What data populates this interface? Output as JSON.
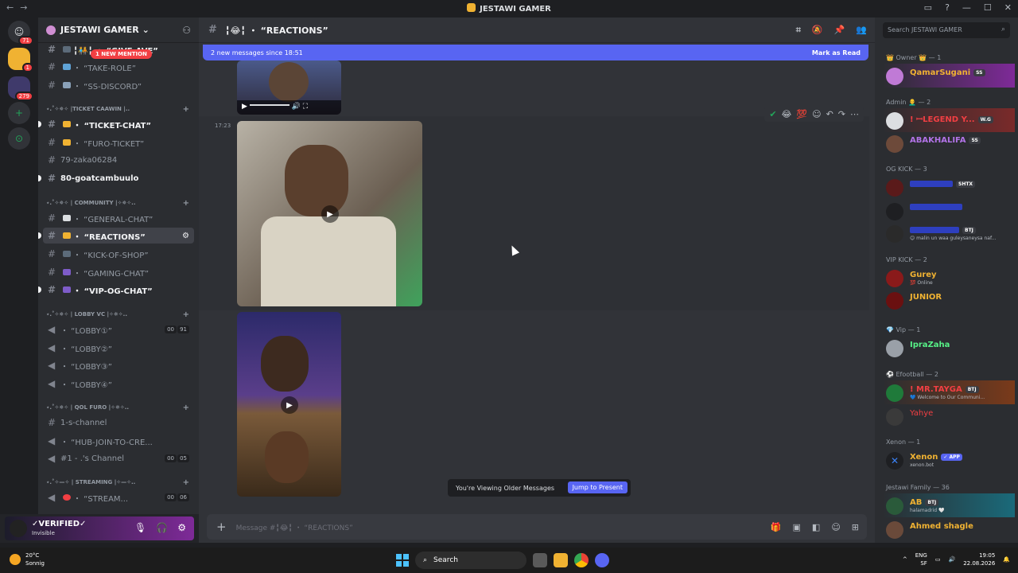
{
  "window": {
    "title": "JESTAWI GAMER",
    "nav_back": "←",
    "nav_forward": "→"
  },
  "server_rail": {
    "top_badge": "71",
    "items": [
      {
        "name": "direct-messages",
        "badge": "71"
      },
      {
        "name": "server-jestawi",
        "badge": "1"
      },
      {
        "name": "server-folder",
        "badge": "279"
      }
    ],
    "add_label": "+",
    "discover_label": "⊙"
  },
  "guild": {
    "name": "JESTAWI GAMER",
    "mention_pill": "1 NEW MENTION",
    "channels": [
      {
        "label": "╏🧑‍🤝‍🧑╏ ・ “GIVE-AVE”",
        "type": "text",
        "style": "bold"
      },
      {
        "label": "・ “TAKE-ROLE”",
        "type": "text",
        "style": "normal"
      },
      {
        "label": "・ “SS-DISCORD”",
        "type": "text",
        "style": "normal"
      },
      {
        "label": "⋆.˚✧✵✧ |TICKET CAAWIN |..",
        "type": "category"
      },
      {
        "label": "・ “TICKET-CHAT”",
        "type": "text",
        "style": "bold"
      },
      {
        "label": "・ “FURO-TICKET”",
        "type": "text",
        "style": "normal"
      },
      {
        "label": "79-zaka06284",
        "type": "text",
        "style": "normal"
      },
      {
        "label": "80-goatcambuulo",
        "type": "text",
        "style": "bold"
      },
      {
        "label": "⋆.˚✧✵✧ | COMMUNITY |✧✵✧..",
        "type": "category"
      },
      {
        "label": "・ “GENERAL-CHAT”",
        "type": "text",
        "style": "normal"
      },
      {
        "label": "・ “REACTIONS”",
        "type": "text",
        "style": "selected"
      },
      {
        "label": "・ “KICK-OF-SHOP”",
        "type": "text",
        "style": "normal"
      },
      {
        "label": "・ “GAMING-CHAT”",
        "type": "text",
        "style": "normal"
      },
      {
        "label": "・ “VIP-OG-CHAT”",
        "type": "text",
        "style": "bold"
      },
      {
        "label": "⋆.˚✧✵✧ | LOBBY VC |✧✵✧..",
        "type": "category"
      },
      {
        "label": "・ “LOBBY①”",
        "type": "voice",
        "tag1": "00",
        "tag2": "91"
      },
      {
        "label": "・ “LOBBY②”",
        "type": "voice"
      },
      {
        "label": "・ “LOBBY③”",
        "type": "voice"
      },
      {
        "label": "・ “LOBBY④”",
        "type": "voice"
      },
      {
        "label": "⋆.˚✧✵✧ | QOL FURO |✧✵✧..",
        "type": "category"
      },
      {
        "label": "1-s-channel",
        "type": "text",
        "style": "normal"
      },
      {
        "label": "・ “HUB-JOIN-TO-CRE...",
        "type": "voice"
      },
      {
        "label": "#1 - .'s Channel",
        "type": "voice",
        "tag1": "00",
        "tag2": "05"
      },
      {
        "label": "⋆.˚✧—✧ | STREAMING |✧—✧..",
        "type": "category"
      },
      {
        "label": "・ “STREAM...",
        "type": "voice",
        "tag1": "00",
        "tag2": "06"
      }
    ]
  },
  "user": {
    "name": "✓VERIFIED✓",
    "status": "Invisible"
  },
  "header": {
    "channel": "╏😂╏ ・ “REACTIONS”"
  },
  "banner": {
    "text": "2 new messages since 18:51",
    "action": "Mark as Read"
  },
  "message": {
    "timestamp": "17:23"
  },
  "older": {
    "text": "You're Viewing Older Messages",
    "action": "Jump to Present"
  },
  "composer": {
    "placeholder": "Message #╏😂╏ ・ “REACTIONS”"
  },
  "members_panel": {
    "search_placeholder": "Search JESTAWI GAMER",
    "groups": [
      {
        "title": "👑 Owner 👑 — 1",
        "members": [
          {
            "name": "QamarSugani",
            "tag": "SS",
            "color": "#f0b232",
            "sub": ""
          }
        ]
      },
      {
        "title": "Admin 👨‍🦲 — 2",
        "members": [
          {
            "name": "! ꟷLEGEND Y...",
            "tag": "W.G",
            "color": "#f23f43",
            "sub": ""
          },
          {
            "name": "ABAKHALIFA",
            "tag": "SS",
            "color": "#b273e8",
            "sub": ""
          }
        ]
      },
      {
        "title": "OG KICK — 3",
        "members": [
          {
            "name": "",
            "tag": "SHTX",
            "color": "#3b5bdb",
            "sub": ""
          },
          {
            "name": "",
            "tag": "",
            "color": "#3b5bdb",
            "sub": ""
          },
          {
            "name": "",
            "tag": "BTJ",
            "color": "#3b5bdb",
            "sub": "😊 malin un waa guleysaneysa naf..."
          }
        ]
      },
      {
        "title": "VIP KICK — 2",
        "members": [
          {
            "name": "Gurey",
            "tag": "",
            "color": "#f0b232",
            "sub": "💯 Online"
          },
          {
            "name": "JUNIOR",
            "tag": "",
            "color": "#f0b232",
            "sub": ""
          }
        ]
      },
      {
        "title": "💎 Vip — 1",
        "members": [
          {
            "name": "IpraZaha",
            "tag": "",
            "color": "#57f287",
            "sub": ""
          }
        ]
      },
      {
        "title": "⚽ Efootball — 2",
        "members": [
          {
            "name": "! MR.TAYGA",
            "tag": "BTJ",
            "color": "#f23f43",
            "sub": "💙 Welcome to Our Communi..."
          },
          {
            "name": "Yahye",
            "tag": "",
            "color": "#f23f43",
            "sub": ""
          }
        ]
      },
      {
        "title": "Xenon — 1",
        "members": [
          {
            "name": "Xenon",
            "tag": "✓ APP",
            "color": "#f0b232",
            "sub": "xenon.bot"
          }
        ]
      },
      {
        "title": "Jestawi Family — 36",
        "members": [
          {
            "name": "AB",
            "tag": "BTJ",
            "color": "#f0b232",
            "sub": "halamadrid 🤍"
          },
          {
            "name": "Ahmed shagle",
            "tag": "",
            "color": "#f0b232",
            "sub": ""
          }
        ]
      }
    ]
  },
  "taskbar": {
    "weather_temp": "20°C",
    "weather_desc": "Sonnig",
    "search": "Search",
    "lang": "ENG",
    "lang2": "SF",
    "time": "19:05",
    "date": "22.08.2026"
  },
  "colors": {
    "accent": "#5865f2",
    "danger": "#f23f43",
    "success": "#23a55a"
  }
}
